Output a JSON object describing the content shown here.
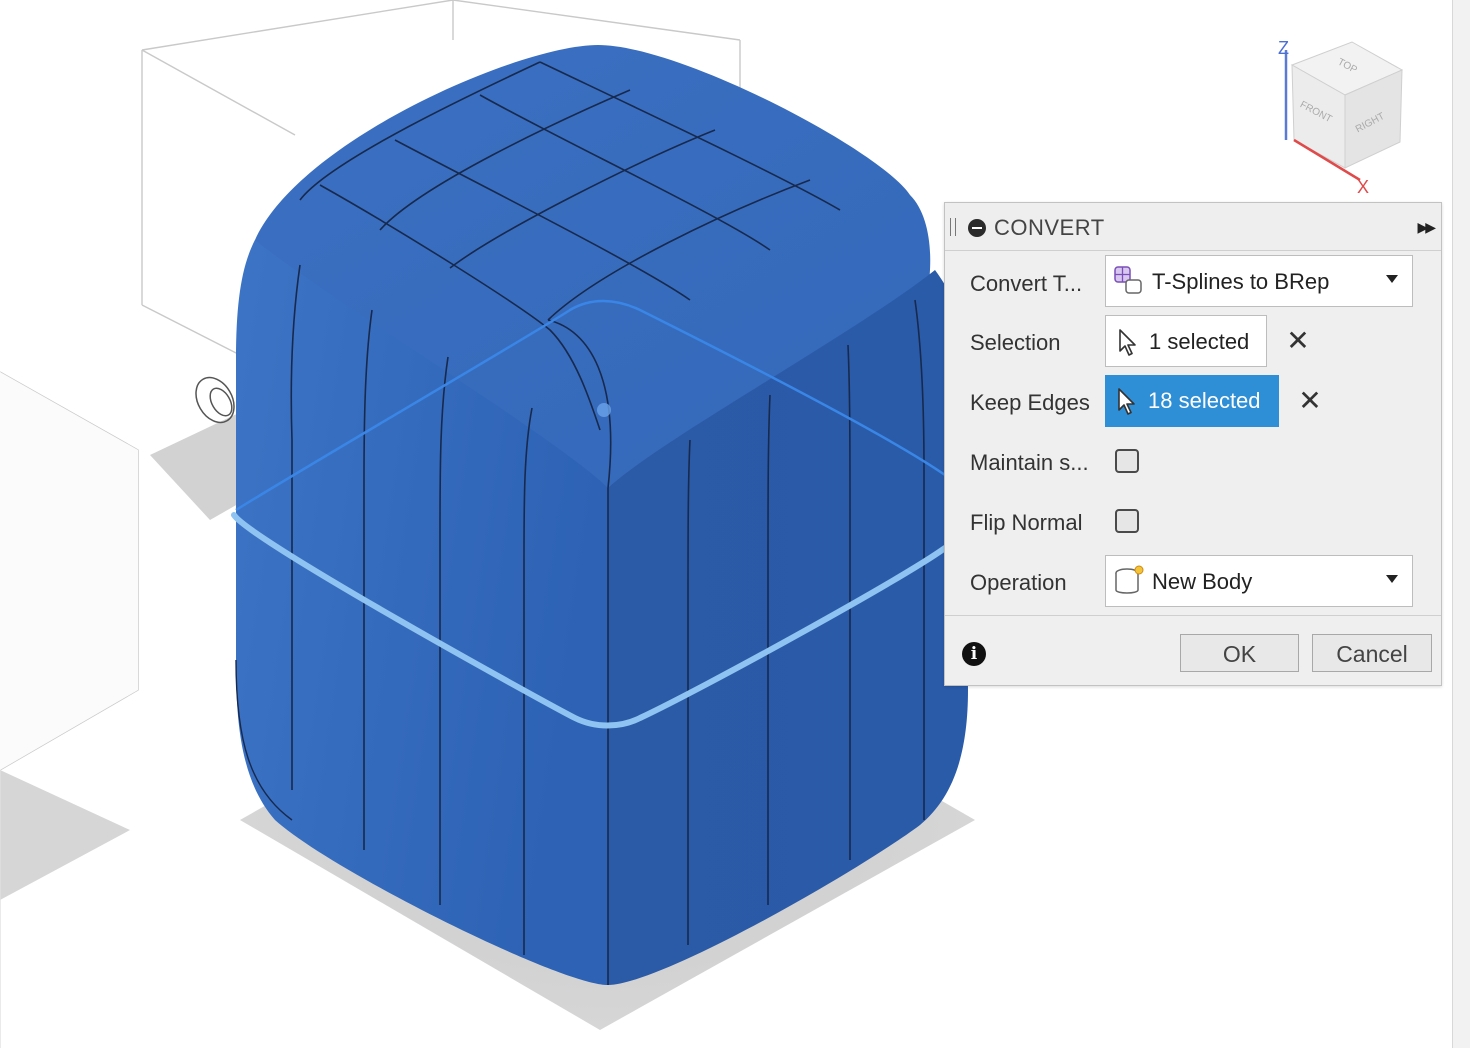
{
  "view_cube": {
    "axis_z": "Z",
    "axis_x": "X",
    "face_top": "TOP",
    "face_front": "FRONT",
    "face_right": "RIGHT"
  },
  "dialog": {
    "title": "CONVERT",
    "rows": {
      "convert_type": {
        "label": "Convert T...",
        "value": "T-Splines to BRep",
        "icon": "tsplines-to-brep-icon"
      },
      "selection": {
        "label": "Selection",
        "value": "1 selected"
      },
      "keep_edges": {
        "label": "Keep Edges",
        "value": "18 selected"
      },
      "maintain": {
        "label": "Maintain s...",
        "checked": false
      },
      "flip_normal": {
        "label": "Flip Normal",
        "checked": false
      },
      "operation": {
        "label": "Operation",
        "value": "New Body",
        "icon": "new-body-icon"
      }
    },
    "ok_label": "OK",
    "cancel_label": "Cancel"
  },
  "colors": {
    "body_blue": "#2f5fae",
    "active_selection": "#2f8fd6",
    "highlight_ring": "#e03a2a"
  }
}
